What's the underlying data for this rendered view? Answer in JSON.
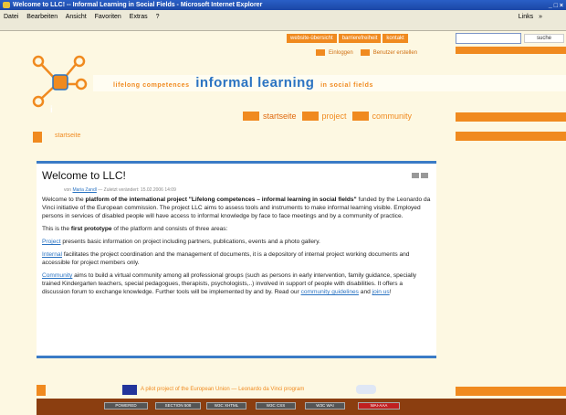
{
  "window": {
    "title": "Welcome to LLC! -- Informal Learning in Social Fields - Microsoft Internet Explorer",
    "controls": "_ □ ×"
  },
  "menubar": {
    "items": [
      "Datei",
      "Bearbeiten",
      "Ansicht",
      "Favoriten",
      "Extras",
      "?"
    ],
    "links_label": "Links",
    "links_arrows": "»"
  },
  "header": {
    "top_links": [
      "website-übersicht",
      "barrierefreiheit",
      "kontakt"
    ],
    "search_placeholder": "",
    "search_button": "suche",
    "login_links": [
      "Einloggen",
      "Benutzer erstellen"
    ]
  },
  "logo": {
    "letter": "i"
  },
  "banner": {
    "prefix": "lifelong competences",
    "main": "informal learning",
    "suffix": "in social fields"
  },
  "nav": {
    "items": [
      "startseite",
      "project",
      "community"
    ]
  },
  "breadcrumb": {
    "current": "startseite"
  },
  "article": {
    "title": "Welcome to LLC!",
    "meta_prefix": "von",
    "author": "Maria Zandl",
    "meta_suffix": "— Zuletzt verändert: 15.02.2006 14:09",
    "p1_a": "Welcome to the ",
    "p1_b": "platform of the international project \"Lifelong competences – informal learning in social fields\"",
    "p1_c": " funded by the Leonardo da Vinci initiative of the European commission. The project LLC aims to assess tools and instruments to make informal learning visible. Employed persons in services of disabled people will have access to informal knowledge by face to face meetings and by a community of practice.",
    "p2_a": "This is the ",
    "p2_b": "first prototype",
    "p2_c": " of the platform and consists of three areas:",
    "p3_link": "Project",
    "p3_text": " presents basic information on project including partners, publications, events and a photo gallery.",
    "p4_link": "Internal",
    "p4_text": " facilitates the project coordination and the management of documents, it is a depository of internal project working documents and accessible for project members only.",
    "p5_link": "Community",
    "p5_text": " aims to build a virtual community among all professional groups (such as persons in early intervention, family guidance, specially trained Kindergarten teachers, special pedagogues, therapists, psychologists,..) involved in support of people with disabilities. It offers a discussion forum to exchange knowledge. Further tools will be implemented by and by. Read our ",
    "p5_link2": "community guidelines",
    "p5_and": " and ",
    "p5_link3": "join us",
    "p5_end": "!"
  },
  "footer": {
    "eu_text": "A pilot project of the European Union — Leonardo da Vinci program",
    "badges": [
      "POWERED",
      "SECTION 508",
      "W3C XHTML",
      "W3C CSS",
      "W3C WAI",
      "WAI-AAA"
    ]
  },
  "colors": {
    "accent_orange": "#f08a1f",
    "link_blue": "#2a73c2",
    "page_bg": "#fdf8e2",
    "footer_brown": "#8b3e10"
  }
}
